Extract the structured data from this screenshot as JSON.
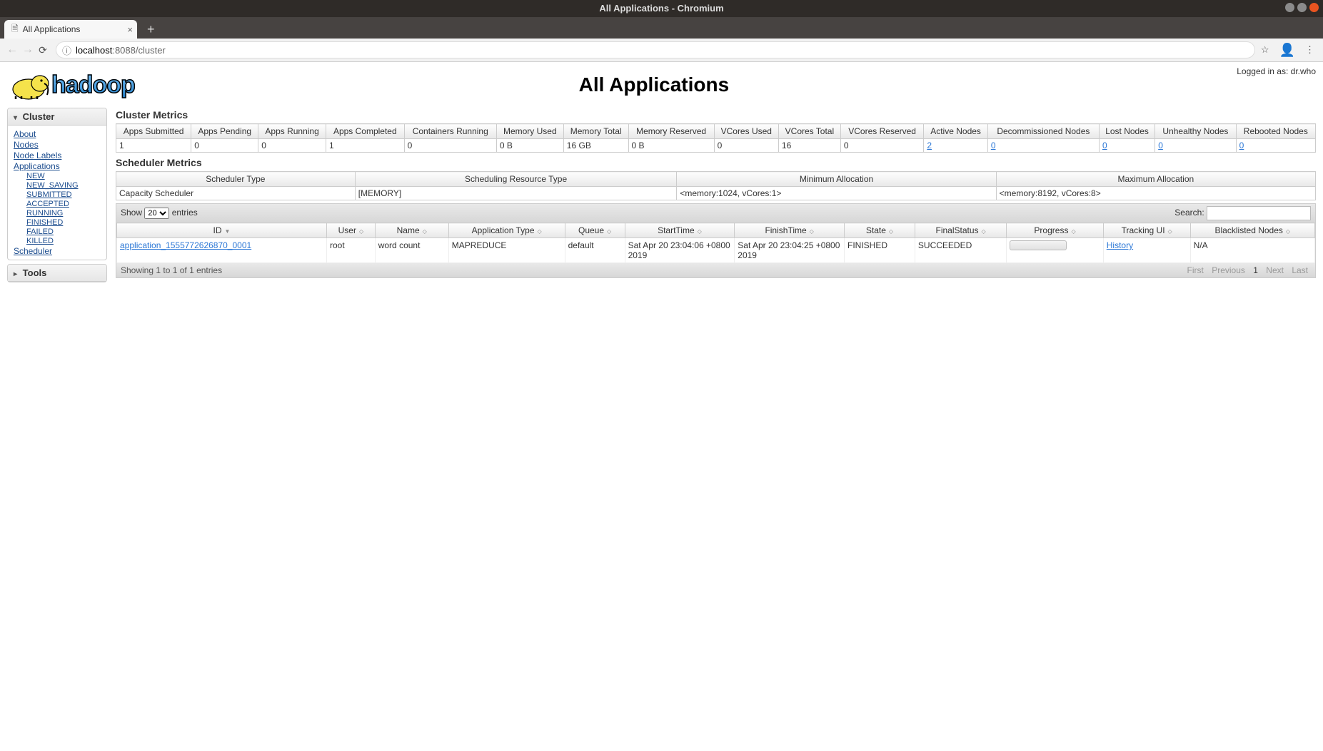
{
  "window": {
    "title": "All Applications - Chromium"
  },
  "tab": {
    "title": "All Applications"
  },
  "url": {
    "host": "localhost",
    "rest": ":8088/cluster"
  },
  "login": {
    "text": "Logged in as: dr.who"
  },
  "page": {
    "title": "All Applications",
    "logo_word": "hadoop"
  },
  "sidebar": {
    "cluster_label": "Cluster",
    "links": {
      "about": "About",
      "nodes": "Nodes",
      "node_labels": "Node Labels",
      "applications": "Applications",
      "new": "NEW",
      "new_saving": "NEW_SAVING",
      "submitted": "SUBMITTED",
      "accepted": "ACCEPTED",
      "running": "RUNNING",
      "finished": "FINISHED",
      "failed": "FAILED",
      "killed": "KILLED",
      "scheduler": "Scheduler"
    },
    "tools_label": "Tools"
  },
  "cluster_metrics": {
    "title": "Cluster Metrics",
    "headers": [
      "Apps Submitted",
      "Apps Pending",
      "Apps Running",
      "Apps Completed",
      "Containers Running",
      "Memory Used",
      "Memory Total",
      "Memory Reserved",
      "VCores Used",
      "VCores Total",
      "VCores Reserved",
      "Active Nodes",
      "Decommissioned Nodes",
      "Lost Nodes",
      "Unhealthy Nodes",
      "Rebooted Nodes"
    ],
    "values": [
      "1",
      "0",
      "0",
      "1",
      "0",
      "0 B",
      "16 GB",
      "0 B",
      "0",
      "16",
      "0",
      "2",
      "0",
      "0",
      "0",
      "0"
    ],
    "link_cols": [
      11,
      12,
      13,
      14,
      15
    ]
  },
  "scheduler_metrics": {
    "title": "Scheduler Metrics",
    "headers": [
      "Scheduler Type",
      "Scheduling Resource Type",
      "Minimum Allocation",
      "Maximum Allocation"
    ],
    "values": [
      "Capacity Scheduler",
      "[MEMORY]",
      "<memory:1024, vCores:1>",
      "<memory:8192, vCores:8>"
    ]
  },
  "apps_table": {
    "show_label": "Show",
    "show_value": "20",
    "entries_label": "entries",
    "search_label": "Search:",
    "headers": [
      "ID",
      "User",
      "Name",
      "Application Type",
      "Queue",
      "StartTime",
      "FinishTime",
      "State",
      "FinalStatus",
      "Progress",
      "Tracking UI",
      "Blacklisted Nodes"
    ],
    "row": {
      "id": "application_1555772626870_0001",
      "user": "root",
      "name": "word count",
      "apptype": "MAPREDUCE",
      "queue": "default",
      "start": "Sat Apr 20 23:04:06 +0800 2019",
      "finish": "Sat Apr 20 23:04:25 +0800 2019",
      "state": "FINISHED",
      "final": "SUCCEEDED",
      "tracking": "History",
      "blacklisted": "N/A"
    },
    "footer_left": "Showing 1 to 1 of 1 entries",
    "pager": {
      "first": "First",
      "prev": "Previous",
      "page": "1",
      "next": "Next",
      "last": "Last"
    }
  }
}
